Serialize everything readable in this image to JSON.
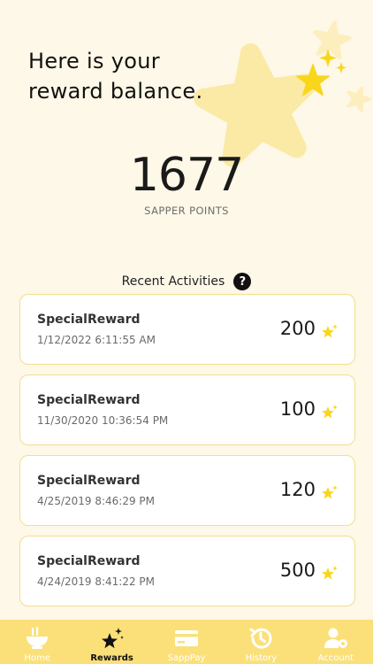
{
  "header": {
    "line1": "Here is your",
    "line2": "reward balance."
  },
  "balance": {
    "points": "1677",
    "caption": "SAPPER POINTS"
  },
  "activities": {
    "title": "Recent Activities",
    "help_glyph": "?",
    "items": [
      {
        "type": "SpecialReward",
        "timestamp": "1/12/2022 6:11:55 AM",
        "points": "200"
      },
      {
        "type": "SpecialReward",
        "timestamp": "11/30/2020 10:36:54 PM",
        "points": "100"
      },
      {
        "type": "SpecialReward",
        "timestamp": "4/25/2019 8:46:29 PM",
        "points": "120"
      },
      {
        "type": "SpecialReward",
        "timestamp": "4/24/2019 8:41:22 PM",
        "points": "500"
      }
    ]
  },
  "tabbar": {
    "active": "Rewards",
    "tabs": [
      {
        "label": "Home",
        "icon": "bowl-icon"
      },
      {
        "label": "Rewards",
        "icon": "stars-icon"
      },
      {
        "label": "SappPay",
        "icon": "card-icon"
      },
      {
        "label": "History",
        "icon": "history-icon"
      },
      {
        "label": "Account",
        "icon": "account-settings-icon"
      }
    ]
  },
  "colors": {
    "background": "#fdf8e7",
    "accent": "#fbe07a",
    "star": "#f9d61c",
    "card_border": "#f3de8f"
  }
}
